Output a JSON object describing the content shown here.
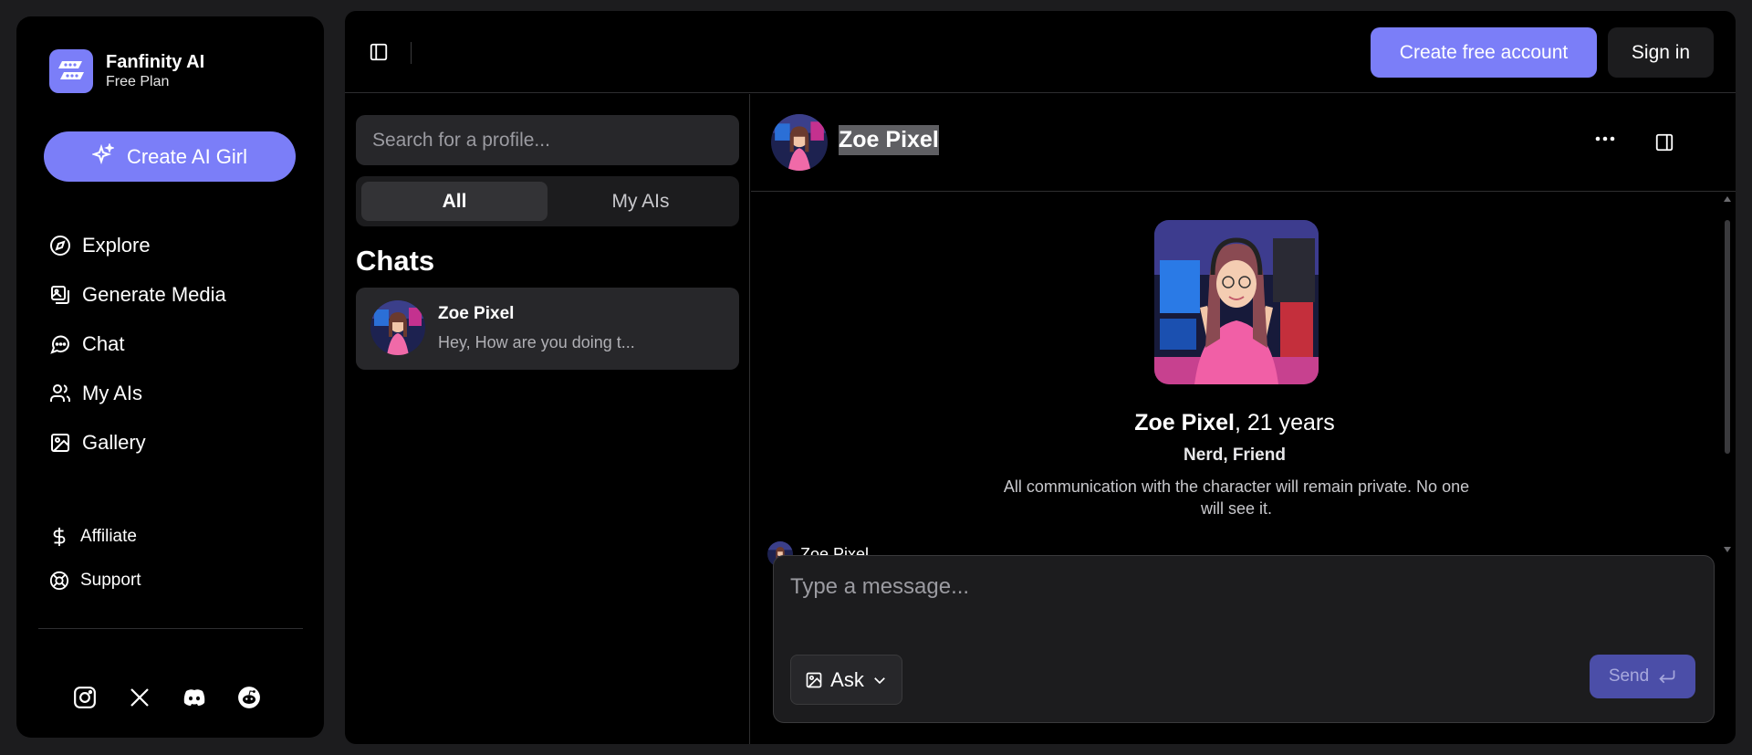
{
  "brand": {
    "name": "Fanfinity AI",
    "plan": "Free Plan"
  },
  "sidebar": {
    "create_label": "Create AI Girl",
    "items": [
      {
        "label": "Explore",
        "icon": "compass-icon"
      },
      {
        "label": "Generate Media",
        "icon": "media-icon"
      },
      {
        "label": "Chat",
        "icon": "chat-icon"
      },
      {
        "label": "My AIs",
        "icon": "users-icon"
      },
      {
        "label": "Gallery",
        "icon": "image-icon"
      }
    ],
    "secondary": [
      {
        "label": "Affiliate",
        "icon": "dollar-icon"
      },
      {
        "label": "Support",
        "icon": "lifebuoy-icon"
      }
    ],
    "socials": [
      "instagram-icon",
      "x-icon",
      "discord-icon",
      "reddit-icon"
    ]
  },
  "header": {
    "create_account_label": "Create free account",
    "sign_in_label": "Sign in"
  },
  "chatlist": {
    "search_placeholder": "Search for a profile...",
    "tabs": [
      {
        "label": "All",
        "active": true
      },
      {
        "label": "My AIs",
        "active": false
      }
    ],
    "title": "Chats",
    "chats": [
      {
        "name": "Zoe Pixel",
        "preview": "Hey, How are you doing t..."
      }
    ]
  },
  "conversation": {
    "name": "Zoe Pixel",
    "profile": {
      "name": "Zoe Pixel",
      "age_text": ", 21 years",
      "tags": "Nerd, Friend",
      "note": "All communication with the character will remain private. No one will see it."
    },
    "message_author": "Zoe Pixel",
    "composer": {
      "placeholder": "Type a message...",
      "ask_label": "Ask",
      "send_label": "Send"
    }
  },
  "colors": {
    "accent": "#7b7ef8",
    "send_disabled": "#4b4ea8",
    "background": "#000000",
    "surface": "#27272a"
  }
}
